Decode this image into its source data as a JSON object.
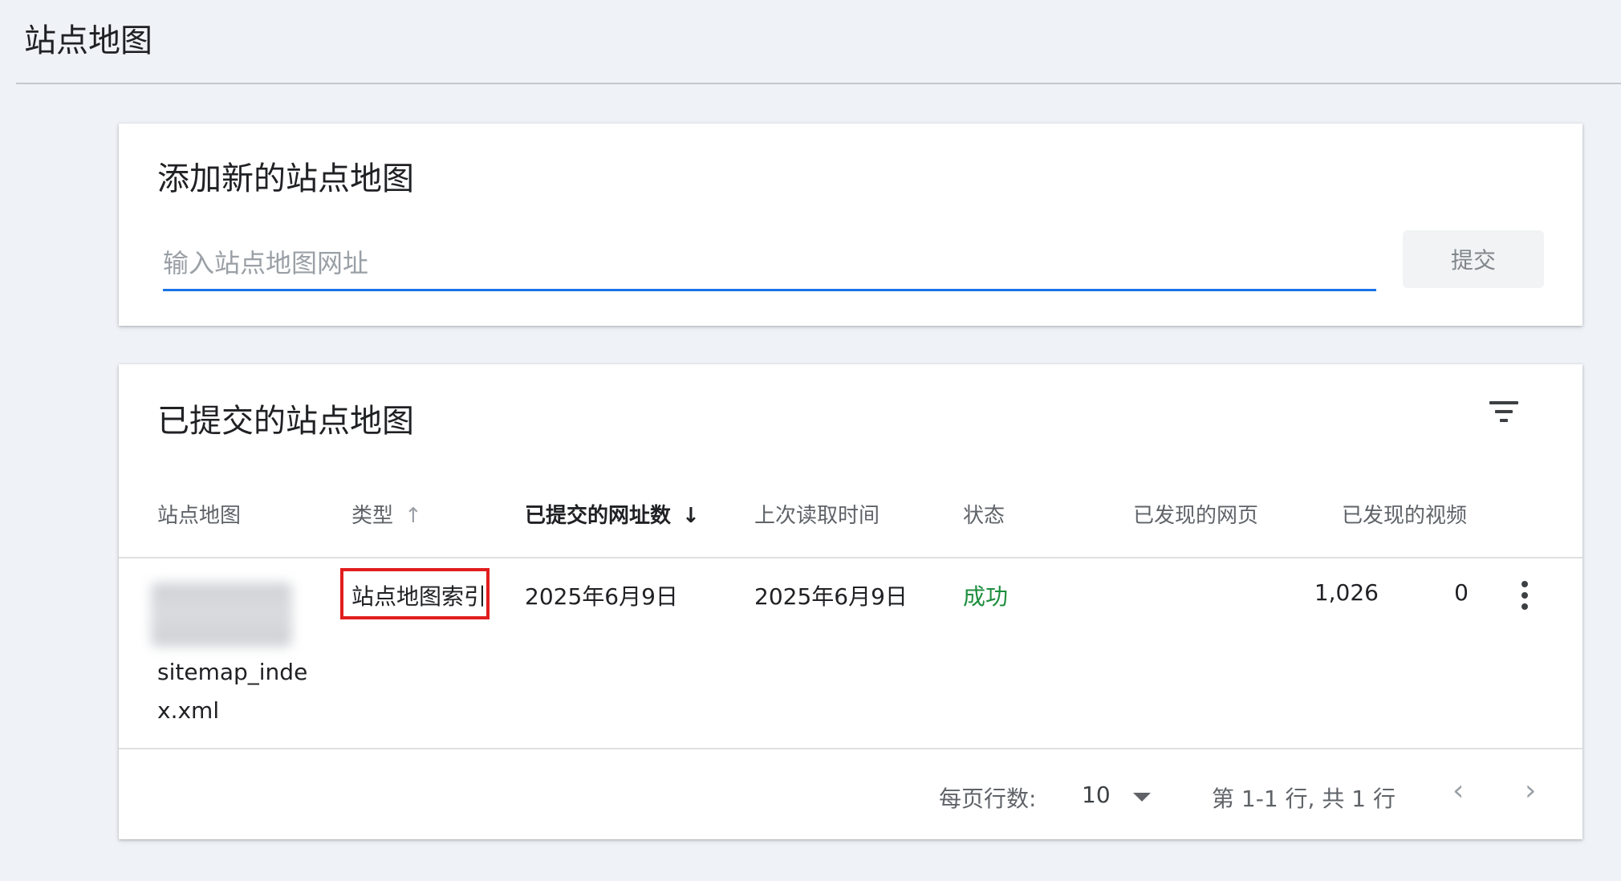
{
  "page": {
    "title": "站点地图"
  },
  "add_sitemap": {
    "title": "添加新的站点地图",
    "input_placeholder": "输入站点地图网址",
    "input_value": "",
    "submit_label": "提交"
  },
  "submitted": {
    "title": "已提交的站点地图",
    "columns": {
      "sitemap": "站点地图",
      "type": "类型",
      "submitted_urls": "已提交的网址数",
      "last_read": "上次读取时间",
      "status": "状态",
      "discovered_pages": "已发现的网页",
      "discovered_videos": "已发现的视频"
    },
    "sort": {
      "type_arrow": "↑",
      "submitted_urls_arrow": "↓"
    },
    "rows": [
      {
        "sitemap": "sitemap_index.xml",
        "type": "站点地图索引",
        "submitted": "2025年6月9日",
        "last_read": "2025年6月9日",
        "status": "成功",
        "discovered_pages": "1,026",
        "discovered_videos": "0"
      }
    ],
    "footer": {
      "rows_per_page_label": "每页行数:",
      "rows_per_page_value": "10",
      "range_text": "第 1-1 行, 共 1 行",
      "prev_glyph": "‹",
      "next_glyph": "›"
    }
  },
  "colors": {
    "accent": "#1a73e8",
    "success": "#1e8e3e",
    "highlight": "#e11d1d",
    "background": "#eff2f7"
  },
  "icons": [
    "filter-icon",
    "more-vert-icon",
    "dropdown-arrow-icon",
    "chevron-left-icon",
    "chevron-right-icon",
    "sort-arrow-up-icon",
    "sort-arrow-down-icon"
  ]
}
